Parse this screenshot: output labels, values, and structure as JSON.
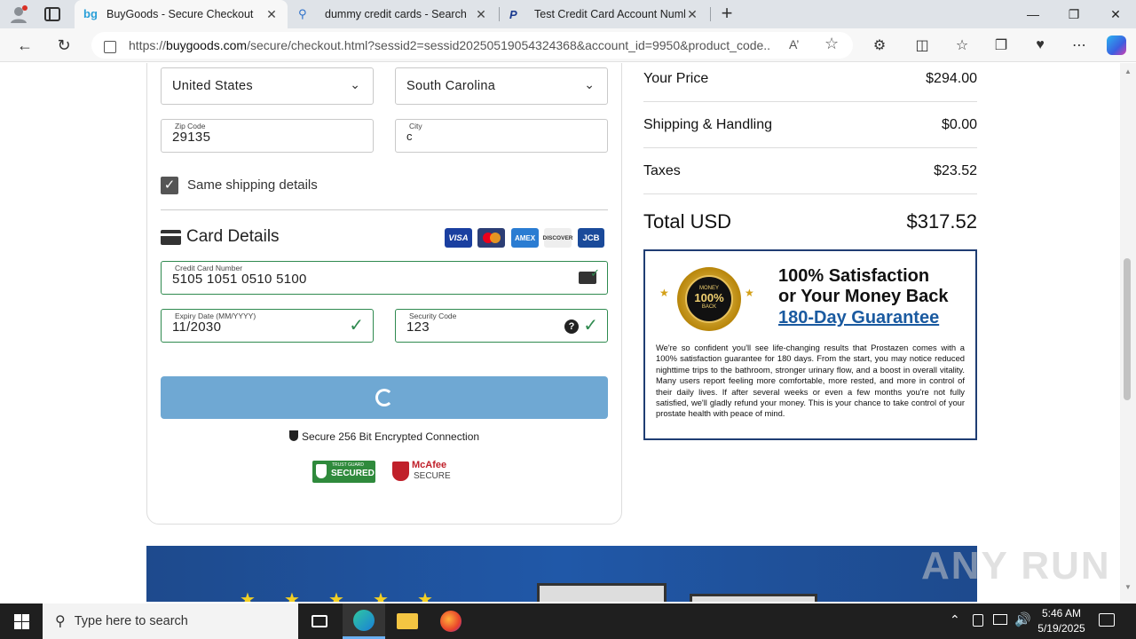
{
  "browser": {
    "tabs": [
      {
        "title": "BuyGoods - Secure Checkout",
        "icon": "buygoods-icon",
        "active": true
      },
      {
        "title": "dummy credit cards - Search",
        "icon": "search-icon",
        "active": false
      },
      {
        "title": "Test Credit Card Account Numbe",
        "icon": "paypal-icon",
        "active": false
      }
    ],
    "new_tab": "+",
    "url_scheme": "https://",
    "url_host": "buygoods.com",
    "url_rest": "/secure/checkout.html?sessid2=sessid20250519054324368&account_id=9950&product_code...",
    "window_controls": {
      "minimize": "—",
      "restore": "❐",
      "close": "✕"
    }
  },
  "form": {
    "country": "United States",
    "state": "South Carolina",
    "zip_label": "Zip Code",
    "zip_value": "29135",
    "city_label": "City",
    "city_value": "c",
    "same_shipping_label": "Same shipping details",
    "same_shipping_checked": true,
    "card_section_title": "Card Details",
    "payment_logos": [
      "VISA",
      "",
      "AMEX",
      "DISCOVER",
      "JCB"
    ],
    "cc_label": "Credit Card Number",
    "cc_value": "5105 1051 0510 5100",
    "expiry_label": "Expiry Date (MM/YYYY)",
    "expiry_value": "11/2030",
    "cvv_label": "Security Code",
    "cvv_value": "123",
    "secure_text": "Secure 256 Bit Encrypted Connection",
    "trust_seal_1_top": "TRUST GUARD",
    "trust_seal_1": "SECURED",
    "trust_seal_2a": "McAfee",
    "trust_seal_2b": "SECURE"
  },
  "summary": {
    "rows": [
      {
        "label": "Your Price",
        "value": "$294.00"
      },
      {
        "label": "Shipping & Handling",
        "value": "$0.00"
      },
      {
        "label": "Taxes",
        "value": "$23.52"
      }
    ],
    "total_label": "Total USD",
    "total_value": "$317.52"
  },
  "guarantee": {
    "badge_text_top": "MONEY",
    "badge_text_mid": "100%",
    "badge_text_bottom": "BACK",
    "headline_1": "100% Satisfaction",
    "headline_2": "or Your Money Back",
    "headline_3": "180-Day Guarantee",
    "body": "We're so confident you'll see life-changing results that Prostazen comes with a 100% satisfaction guarantee for 180 days. From the start, you may notice reduced nighttime trips to the bathroom, stronger urinary flow, and a boost in overall vitality. Many users report feeling more comfortable, more rested, and more in control of their daily lives. If after several weeks or even a few months you're not fully satisfied, we'll gladly refund your money. This is your chance to take control of your prostate health with peace of mind."
  },
  "watermark": "ANY RUN",
  "taskbar": {
    "search_placeholder": "Type here to search",
    "time": "5:46 AM",
    "date": "5/19/2025"
  },
  "colors": {
    "accent_green": "#2f8a4f",
    "submit_blue": "#6fa8d3",
    "guarantee_navy": "#1f3d73",
    "guarantee_link": "#1a5aa0"
  }
}
